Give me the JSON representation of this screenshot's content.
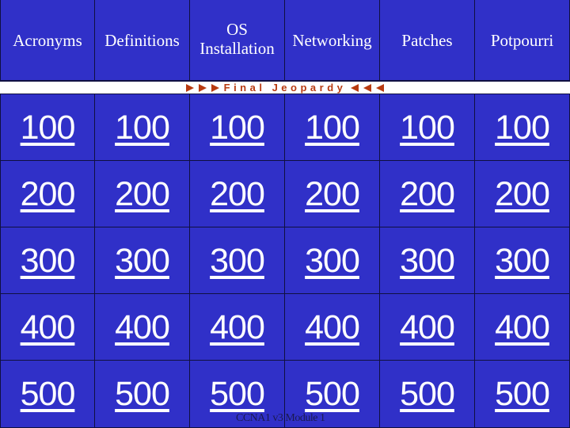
{
  "categories": [
    {
      "label": "Acronyms"
    },
    {
      "label_line1": "Definitions"
    },
    {
      "label_line1": "OS",
      "label_line2": "Installation"
    },
    {
      "label": "Networking"
    },
    {
      "label": "Patches"
    },
    {
      "label": "Potpourri"
    }
  ],
  "category_labels": [
    "Acronyms",
    "Definitions",
    "OS Installation",
    "Networking",
    "Patches",
    "Potpourri"
  ],
  "final_jeopardy": {
    "label": "Final Jeopardy",
    "arrow_color": "#b83a10"
  },
  "rows": [
    {
      "value": "100",
      "cells": [
        "100",
        "100",
        "100",
        "100",
        "100",
        "100"
      ]
    },
    {
      "value": "200",
      "cells": [
        "200",
        "200",
        "200",
        "200",
        "200",
        "200"
      ]
    },
    {
      "value": "300",
      "cells": [
        "300",
        "300",
        "300",
        "300",
        "300",
        "300"
      ]
    },
    {
      "value": "400",
      "cells": [
        "400",
        "400",
        "400",
        "400",
        "400",
        "400"
      ]
    },
    {
      "value": "500",
      "cells": [
        "500",
        "500",
        "500",
        "500",
        "500",
        "500"
      ]
    }
  ],
  "footer": "CCNA1 v3 Module 1",
  "colors": {
    "board": "#3030c8",
    "grid_line": "#101040",
    "text": "#ffffff",
    "final_text": "#b83a10"
  }
}
